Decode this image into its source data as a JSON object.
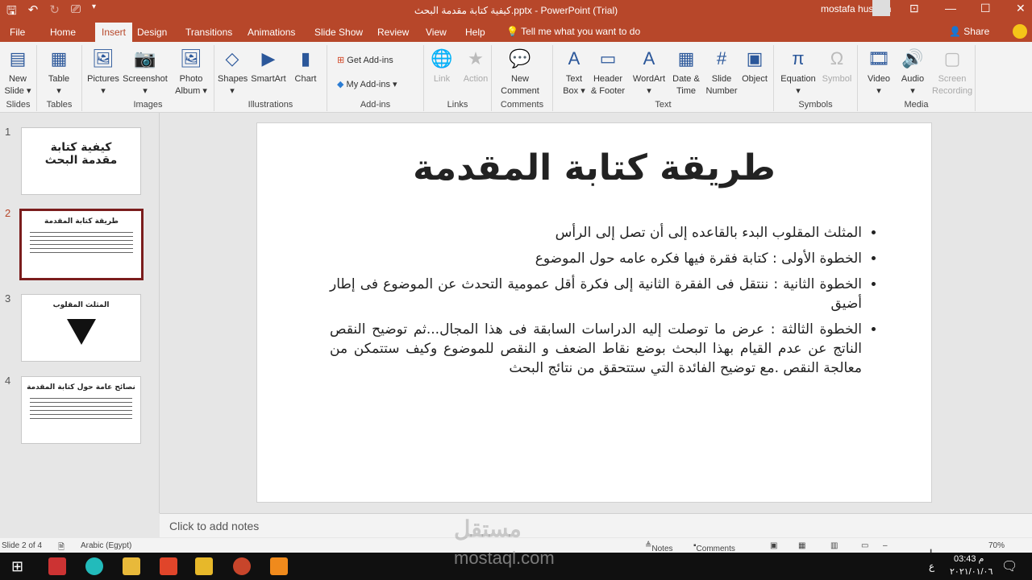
{
  "titlebar": {
    "title": "كيفية كتابة مقدمة البحث.pptx  -  PowerPoint (Trial)",
    "user": "mostafa hussien"
  },
  "tabs": [
    "File",
    "Home",
    "Insert",
    "Design",
    "Transitions",
    "Animations",
    "Slide Show",
    "Review",
    "View",
    "Help"
  ],
  "active_tab": "Insert",
  "tell_me": "Tell me what you want to do",
  "share": "Share",
  "ribbon": {
    "groups": [
      {
        "label": "Slides",
        "items": [
          {
            "l1": "New",
            "l2": "Slide ▾",
            "icon": "new-slide-icon",
            "g": "▤"
          }
        ]
      },
      {
        "label": "Tables",
        "items": [
          {
            "l1": "Table",
            "l2": "▾",
            "icon": "table-icon",
            "g": "▦"
          }
        ]
      },
      {
        "label": "Images",
        "items": [
          {
            "l1": "Pictures",
            "l2": "▾",
            "icon": "pictures-icon",
            "g": "🖼"
          },
          {
            "l1": "Screenshot",
            "l2": "▾",
            "icon": "screenshot-icon",
            "g": "📷"
          },
          {
            "l1": "Photo",
            "l2": "Album ▾",
            "icon": "photo-album-icon",
            "g": "🖼"
          }
        ]
      },
      {
        "label": "Illustrations",
        "items": [
          {
            "l1": "Shapes",
            "l2": "▾",
            "icon": "shapes-icon",
            "g": "◇"
          },
          {
            "l1": "SmartArt",
            "l2": "",
            "icon": "smartart-icon",
            "g": "▶"
          },
          {
            "l1": "Chart",
            "l2": "",
            "icon": "chart-icon",
            "g": "▮"
          }
        ]
      },
      {
        "label": "Add-ins",
        "items": []
      },
      {
        "label": "Links",
        "items": [
          {
            "l1": "Link",
            "l2": "",
            "icon": "link-icon",
            "g": "🌐",
            "dis": true
          },
          {
            "l1": "Action",
            "l2": "",
            "icon": "action-icon",
            "g": "★",
            "dis": true
          }
        ]
      },
      {
        "label": "Comments",
        "items": [
          {
            "l1": "New",
            "l2": "Comment",
            "icon": "new-comment-icon",
            "g": "💬"
          }
        ]
      },
      {
        "label": "Text",
        "items": [
          {
            "l1": "Text",
            "l2": "Box ▾",
            "icon": "text-box-icon",
            "g": "A"
          },
          {
            "l1": "Header",
            "l2": "& Footer",
            "icon": "header-footer-icon",
            "g": "▭"
          },
          {
            "l1": "WordArt",
            "l2": "▾",
            "icon": "wordart-icon",
            "g": "A"
          },
          {
            "l1": "Date &",
            "l2": "Time",
            "icon": "date-time-icon",
            "g": "▦"
          },
          {
            "l1": "Slide",
            "l2": "Number",
            "icon": "slide-number-icon",
            "g": "#"
          },
          {
            "l1": "Object",
            "l2": "",
            "icon": "object-icon",
            "g": "▣"
          }
        ]
      },
      {
        "label": "Symbols",
        "items": [
          {
            "l1": "Equation",
            "l2": "▾",
            "icon": "equation-icon",
            "g": "π"
          },
          {
            "l1": "Symbol",
            "l2": "",
            "icon": "symbol-icon",
            "g": "Ω",
            "dis": true
          }
        ]
      },
      {
        "label": "Media",
        "items": [
          {
            "l1": "Video",
            "l2": "▾",
            "icon": "video-icon",
            "g": "🎞"
          },
          {
            "l1": "Audio",
            "l2": "▾",
            "icon": "audio-icon",
            "g": "🔊"
          },
          {
            "l1": "Screen",
            "l2": "Recording",
            "icon": "screen-recording-icon",
            "g": "▢",
            "dis": true
          }
        ]
      }
    ],
    "addins": {
      "get": "Get Add-ins",
      "my": "My Add-ins"
    }
  },
  "thumbnails": [
    {
      "num": "1",
      "title": "كيفية كتابة مقدمة البحث"
    },
    {
      "num": "2",
      "title": "طريقة كتابة المقدمة"
    },
    {
      "num": "3",
      "title": "المثلث المقلوب"
    },
    {
      "num": "4",
      "title": "نصائح عامة حول كتابة المقدمة"
    }
  ],
  "slide": {
    "title": "طريقة كتابة المقدمة",
    "bullets": [
      "المثلث المقلوب البدء بالقاعده إلى أن تصل إلى الرأس",
      "الخطوة الأولى : كتابة فقرة فيها فكره عامه حول الموضوع",
      "الخطوة الثانية : ننتقل فى الفقرة الثانية إلى فكرة أقل عمومية التحدث عن الموضوع فى إطار أضيق",
      "الخطوة الثالثة : عرض ما توصلت إليه الدراسات السابقة فى هذا المجال...ثم توضيح النقص الناتج عن عدم القيام بهذا البحث بوضع نقاط الضعف و النقص للموضوع وكيف ستتمكن من معالجة النقص .مع توضيح الفائدة التي ستتحقق من نتائج البحث"
    ]
  },
  "notes_placeholder": "Click to add notes",
  "status": {
    "slide": "Slide 2 of 4",
    "language": "Arabic (Egypt)",
    "notes": "Notes",
    "comments": "Comments",
    "zoom": "70%"
  },
  "taskbar": {
    "time": "03:43 م",
    "date": "٢٠٢١/٠١/٠٦",
    "lang": "ع"
  },
  "watermark": {
    "ar": "مستقل",
    "en": "mostaql.com"
  },
  "colors": {
    "accent": "#b7472a",
    "selected_thumb": "#7b1d1d"
  }
}
